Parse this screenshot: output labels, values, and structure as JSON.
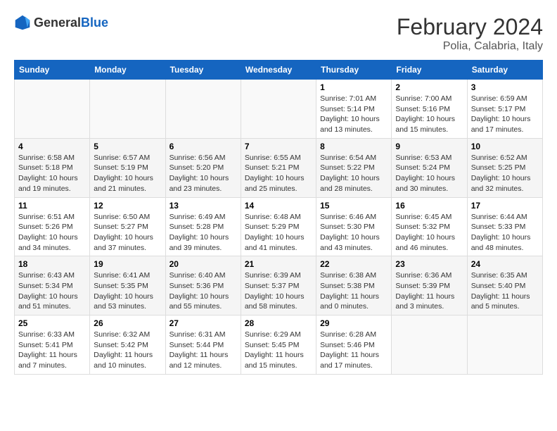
{
  "logo": {
    "general": "General",
    "blue": "Blue"
  },
  "title": "February 2024",
  "subtitle": "Polia, Calabria, Italy",
  "headers": [
    "Sunday",
    "Monday",
    "Tuesday",
    "Wednesday",
    "Thursday",
    "Friday",
    "Saturday"
  ],
  "weeks": [
    [
      {
        "day": "",
        "info": ""
      },
      {
        "day": "",
        "info": ""
      },
      {
        "day": "",
        "info": ""
      },
      {
        "day": "",
        "info": ""
      },
      {
        "day": "1",
        "info": "Sunrise: 7:01 AM\nSunset: 5:14 PM\nDaylight: 10 hours\nand 13 minutes."
      },
      {
        "day": "2",
        "info": "Sunrise: 7:00 AM\nSunset: 5:16 PM\nDaylight: 10 hours\nand 15 minutes."
      },
      {
        "day": "3",
        "info": "Sunrise: 6:59 AM\nSunset: 5:17 PM\nDaylight: 10 hours\nand 17 minutes."
      }
    ],
    [
      {
        "day": "4",
        "info": "Sunrise: 6:58 AM\nSunset: 5:18 PM\nDaylight: 10 hours\nand 19 minutes."
      },
      {
        "day": "5",
        "info": "Sunrise: 6:57 AM\nSunset: 5:19 PM\nDaylight: 10 hours\nand 21 minutes."
      },
      {
        "day": "6",
        "info": "Sunrise: 6:56 AM\nSunset: 5:20 PM\nDaylight: 10 hours\nand 23 minutes."
      },
      {
        "day": "7",
        "info": "Sunrise: 6:55 AM\nSunset: 5:21 PM\nDaylight: 10 hours\nand 25 minutes."
      },
      {
        "day": "8",
        "info": "Sunrise: 6:54 AM\nSunset: 5:22 PM\nDaylight: 10 hours\nand 28 minutes."
      },
      {
        "day": "9",
        "info": "Sunrise: 6:53 AM\nSunset: 5:24 PM\nDaylight: 10 hours\nand 30 minutes."
      },
      {
        "day": "10",
        "info": "Sunrise: 6:52 AM\nSunset: 5:25 PM\nDaylight: 10 hours\nand 32 minutes."
      }
    ],
    [
      {
        "day": "11",
        "info": "Sunrise: 6:51 AM\nSunset: 5:26 PM\nDaylight: 10 hours\nand 34 minutes."
      },
      {
        "day": "12",
        "info": "Sunrise: 6:50 AM\nSunset: 5:27 PM\nDaylight: 10 hours\nand 37 minutes."
      },
      {
        "day": "13",
        "info": "Sunrise: 6:49 AM\nSunset: 5:28 PM\nDaylight: 10 hours\nand 39 minutes."
      },
      {
        "day": "14",
        "info": "Sunrise: 6:48 AM\nSunset: 5:29 PM\nDaylight: 10 hours\nand 41 minutes."
      },
      {
        "day": "15",
        "info": "Sunrise: 6:46 AM\nSunset: 5:30 PM\nDaylight: 10 hours\nand 43 minutes."
      },
      {
        "day": "16",
        "info": "Sunrise: 6:45 AM\nSunset: 5:32 PM\nDaylight: 10 hours\nand 46 minutes."
      },
      {
        "day": "17",
        "info": "Sunrise: 6:44 AM\nSunset: 5:33 PM\nDaylight: 10 hours\nand 48 minutes."
      }
    ],
    [
      {
        "day": "18",
        "info": "Sunrise: 6:43 AM\nSunset: 5:34 PM\nDaylight: 10 hours\nand 51 minutes."
      },
      {
        "day": "19",
        "info": "Sunrise: 6:41 AM\nSunset: 5:35 PM\nDaylight: 10 hours\nand 53 minutes."
      },
      {
        "day": "20",
        "info": "Sunrise: 6:40 AM\nSunset: 5:36 PM\nDaylight: 10 hours\nand 55 minutes."
      },
      {
        "day": "21",
        "info": "Sunrise: 6:39 AM\nSunset: 5:37 PM\nDaylight: 10 hours\nand 58 minutes."
      },
      {
        "day": "22",
        "info": "Sunrise: 6:38 AM\nSunset: 5:38 PM\nDaylight: 11 hours\nand 0 minutes."
      },
      {
        "day": "23",
        "info": "Sunrise: 6:36 AM\nSunset: 5:39 PM\nDaylight: 11 hours\nand 3 minutes."
      },
      {
        "day": "24",
        "info": "Sunrise: 6:35 AM\nSunset: 5:40 PM\nDaylight: 11 hours\nand 5 minutes."
      }
    ],
    [
      {
        "day": "25",
        "info": "Sunrise: 6:33 AM\nSunset: 5:41 PM\nDaylight: 11 hours\nand 7 minutes."
      },
      {
        "day": "26",
        "info": "Sunrise: 6:32 AM\nSunset: 5:42 PM\nDaylight: 11 hours\nand 10 minutes."
      },
      {
        "day": "27",
        "info": "Sunrise: 6:31 AM\nSunset: 5:44 PM\nDaylight: 11 hours\nand 12 minutes."
      },
      {
        "day": "28",
        "info": "Sunrise: 6:29 AM\nSunset: 5:45 PM\nDaylight: 11 hours\nand 15 minutes."
      },
      {
        "day": "29",
        "info": "Sunrise: 6:28 AM\nSunset: 5:46 PM\nDaylight: 11 hours\nand 17 minutes."
      },
      {
        "day": "",
        "info": ""
      },
      {
        "day": "",
        "info": ""
      }
    ]
  ]
}
